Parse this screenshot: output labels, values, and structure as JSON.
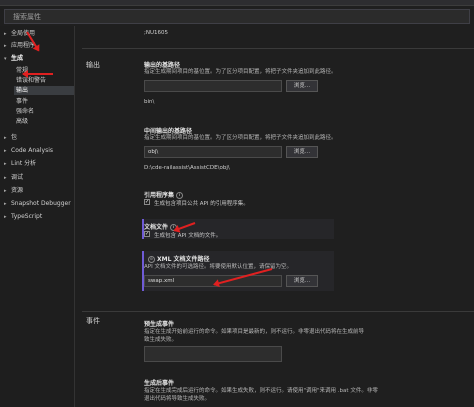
{
  "search": {
    "placeholder": "搜索属性"
  },
  "sidebar": {
    "items": [
      {
        "label": "全局使用",
        "chev": "▸"
      },
      {
        "label": "应用程序",
        "chev": "▸"
      },
      {
        "label": "生成",
        "chev": "▾"
      },
      {
        "label": "常规",
        "chev": ""
      },
      {
        "label": "错误和警告",
        "chev": ""
      },
      {
        "label": "输出",
        "chev": ""
      },
      {
        "label": "事件",
        "chev": ""
      },
      {
        "label": "强命名",
        "chev": ""
      },
      {
        "label": "高级",
        "chev": ""
      },
      {
        "label": "包",
        "chev": "▸"
      },
      {
        "label": "Code Analysis",
        "chev": "▸"
      },
      {
        "label": "Lint 分析",
        "chev": "▸"
      },
      {
        "label": "调试",
        "chev": "▸"
      },
      {
        "label": "资源",
        "chev": "▸"
      },
      {
        "label": "Snapshot Debugger",
        "chev": "▸"
      },
      {
        "label": "TypeScript",
        "chev": "▸"
      }
    ]
  },
  "main": {
    "top_text": ";NU1605",
    "output_section": "输出",
    "events_section": "事件",
    "base_output": {
      "title": "输出的基路径",
      "desc": "指定生成期间项目的基位置。为了区分项目配置，将把子文件夹追加到此路径。",
      "value": "",
      "browse": "浏览...",
      "resolved": "bin\\"
    },
    "intermediate_output": {
      "title": "中间输出的基路径",
      "desc": "指定生成期间项目的基位置。为了区分项目配置，将把子文件夹追加到此路径。",
      "value": "obj\\",
      "browse": "浏览...",
      "resolved": "D:\\cde-railassist\\AssistCDE\\obj\\"
    },
    "reference_assemblies": {
      "title": "引用程序集",
      "checkbox_label": "生成包含项目公共 API 的引用程序集。",
      "checked": true
    },
    "documentation_file": {
      "title": "文档文件",
      "checkbox_label": "生成包含 API 文档的文件。",
      "checked": true
    },
    "xml_doc_path": {
      "title": "XML 文档文件路径",
      "desc": "API 文档文件的可选路径。将要使用默认位置，请保留为空。",
      "value": "swap.xml",
      "browse": "浏览..."
    },
    "pre_build": {
      "title": "预生成事件",
      "desc_line1": "指定在生成开始前运行的命令。如果项目是最新的，则不运行。非零退出代码将在生成前导",
      "desc_line2": "致生成失败。"
    },
    "post_build": {
      "title": "生成后事件",
      "desc_line1": "指定在生成完成后运行的命令。如果生成失败，则不运行。请使用\"调用\"来调用 .bat 文件。非零",
      "desc_line2": "退出代码将导致生成失败。"
    }
  },
  "colors": {
    "accent": "#6f5bd6",
    "arrow": "#e02020",
    "background": "#1f1f1f"
  }
}
